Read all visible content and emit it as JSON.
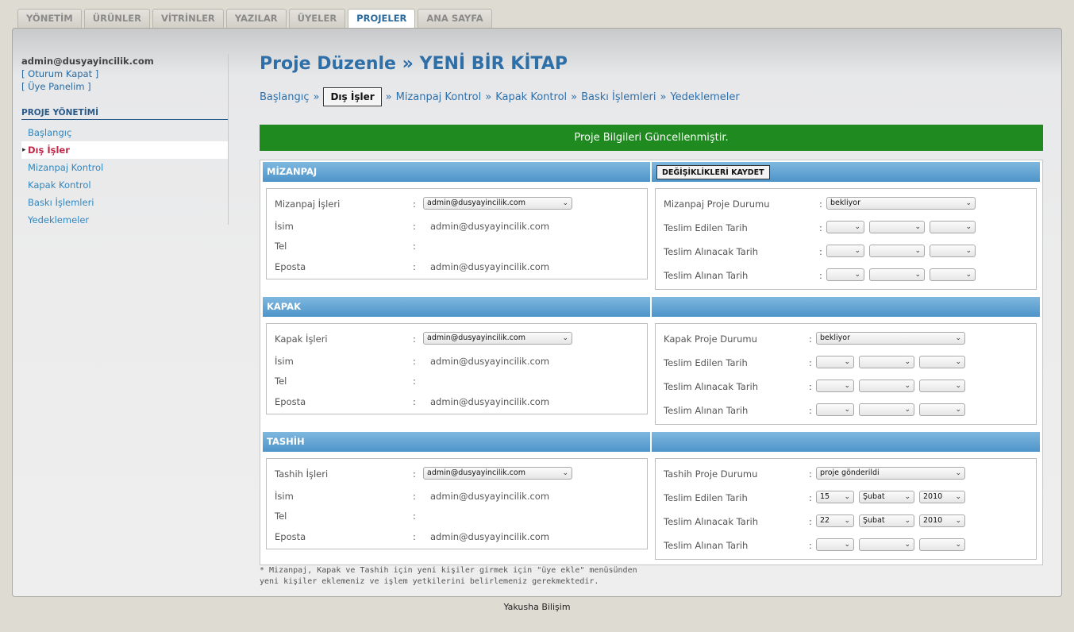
{
  "tabs": [
    "YÖNETİM",
    "ÜRÜNLER",
    "VİTRİNLER",
    "YAZILAR",
    "ÜYELER",
    "PROJELER",
    "ANA SAYFA"
  ],
  "active_tab_index": 5,
  "sidebar": {
    "user_email": "admin@dusyayincilik.com",
    "logout": "[ Oturum Kapat ]",
    "member_panel": "[ Üye Panelim ]",
    "section_title": "PROJE YÖNETİMİ",
    "items": [
      "Başlangıç",
      "Dış İşler",
      "Mizanpaj Kontrol",
      "Kapak Kontrol",
      "Baskı İşlemleri",
      "Yedeklemeler"
    ],
    "active_index": 1
  },
  "page": {
    "title": "Proje Düzenle » YENİ BİR KİTAP",
    "steps": [
      "Başlangıç",
      "Dış İşler",
      "Mizanpaj Kontrol",
      "Kapak Kontrol",
      "Baskı İşlemleri",
      "Yedeklemeler"
    ],
    "step_separator": "»",
    "alert": "Proje Bilgileri Güncellenmiştir.",
    "save_button": "DEĞİŞİKLİKLERİ KAYDET",
    "note_line1": "* Mizanpaj, Kapak ve Tashih için yeni kişiler girmek için \"üye ekle\" menüsünden",
    "note_line2": "yeni kişiler eklemeniz ve işlem yetkilerini belirlemeniz gerekmektedir."
  },
  "common_labels": {
    "colon": ":",
    "name": "İsim",
    "tel": "Tel",
    "email": "Eposta",
    "delivered_date": "Teslim Edilen Tarih",
    "to_receive_date": "Teslim Alınacak Tarih",
    "received_date": "Teslim Alınan Tarih"
  },
  "sections": [
    {
      "title": "MİZANPAJ",
      "works_label": "Mizanpaj İşleri",
      "works_value": "admin@dusyayincilik.com",
      "name_value": "admin@dusyayincilik.com",
      "tel_value": "",
      "email_value": "admin@dusyayincilik.com",
      "status_label": "Mizanpaj Proje Durumu",
      "status_value": "bekliyor",
      "delivered": [
        "",
        "",
        ""
      ],
      "to_receive": [
        "",
        "",
        ""
      ],
      "received": [
        "",
        "",
        ""
      ]
    },
    {
      "title": "KAPAK",
      "works_label": "Kapak İşleri",
      "works_value": "admin@dusyayincilik.com",
      "name_value": "admin@dusyayincilik.com",
      "tel_value": "",
      "email_value": "admin@dusyayincilik.com",
      "status_label": "Kapak Proje Durumu",
      "status_value": "bekliyor",
      "delivered": [
        "",
        "",
        ""
      ],
      "to_receive": [
        "",
        "",
        ""
      ],
      "received": [
        "",
        "",
        ""
      ]
    },
    {
      "title": "TASHİH",
      "works_label": "Tashih İşleri",
      "works_value": "admin@dusyayincilik.com",
      "name_value": "admin@dusyayincilik.com",
      "tel_value": "",
      "email_value": "admin@dusyayincilik.com",
      "status_label": "Tashih Proje Durumu",
      "status_value": "proje gönderildi",
      "delivered": [
        "15",
        "Şubat",
        "2010"
      ],
      "to_receive": [
        "22",
        "Şubat",
        "2010"
      ],
      "received": [
        "",
        "",
        ""
      ]
    }
  ],
  "footer": "Yakusha Bilişim",
  "colors": {
    "accent": "#2f6fa8",
    "alert_bg": "#1f8a1f",
    "section_head": "#5a9dd0",
    "active_sidebar": "#c0284a"
  }
}
